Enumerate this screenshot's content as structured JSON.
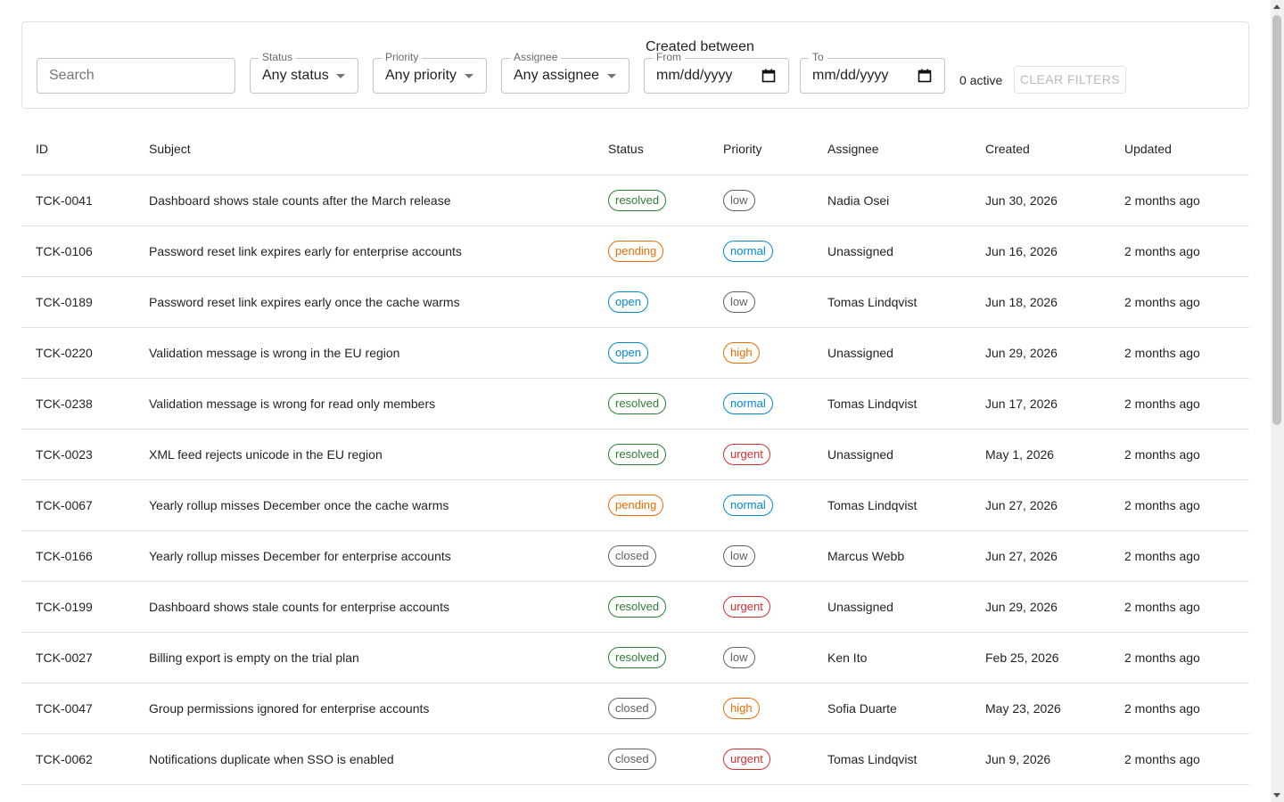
{
  "filters": {
    "search": {
      "placeholder": "Search",
      "value": ""
    },
    "status": {
      "label": "Status",
      "value": "Any status"
    },
    "priority": {
      "label": "Priority",
      "value": "Any priority"
    },
    "assignee": {
      "label": "Assignee",
      "value": "Any assignee"
    },
    "created_group_label": "Created between",
    "from": {
      "label": "From",
      "value": "mm/dd/yyyy"
    },
    "to": {
      "label": "To",
      "value": "mm/dd/yyyy"
    },
    "active_count": "0 active",
    "clear_label": "CLEAR FILTERS"
  },
  "table": {
    "columns": [
      "ID",
      "Subject",
      "Status",
      "Priority",
      "Assignee",
      "Created",
      "Updated"
    ],
    "rows": [
      [
        "TCK-0041",
        "Dashboard shows stale counts after the March release",
        "resolved",
        "low",
        "Nadia Osei",
        "Jun 30, 2026",
        "2 months ago"
      ],
      [
        "TCK-0106",
        "Password reset link expires early for enterprise accounts",
        "pending",
        "normal",
        "Unassigned",
        "Jun 16, 2026",
        "2 months ago"
      ],
      [
        "TCK-0189",
        "Password reset link expires early once the cache warms",
        "open",
        "low",
        "Tomas Lindqvist",
        "Jun 18, 2026",
        "2 months ago"
      ],
      [
        "TCK-0220",
        "Validation message is wrong in the EU region",
        "open",
        "high",
        "Unassigned",
        "Jun 29, 2026",
        "2 months ago"
      ],
      [
        "TCK-0238",
        "Validation message is wrong for read only members",
        "resolved",
        "normal",
        "Tomas Lindqvist",
        "Jun 17, 2026",
        "2 months ago"
      ],
      [
        "TCK-0023",
        "XML feed rejects unicode in the EU region",
        "resolved",
        "urgent",
        "Unassigned",
        "May 1, 2026",
        "2 months ago"
      ],
      [
        "TCK-0067",
        "Yearly rollup misses December once the cache warms",
        "pending",
        "normal",
        "Tomas Lindqvist",
        "Jun 27, 2026",
        "2 months ago"
      ],
      [
        "TCK-0166",
        "Yearly rollup misses December for enterprise accounts",
        "closed",
        "low",
        "Marcus Webb",
        "Jun 27, 2026",
        "2 months ago"
      ],
      [
        "TCK-0199",
        "Dashboard shows stale counts for enterprise accounts",
        "resolved",
        "urgent",
        "Unassigned",
        "Jun 29, 2026",
        "2 months ago"
      ],
      [
        "TCK-0027",
        "Billing export is empty on the trial plan",
        "resolved",
        "low",
        "Ken Ito",
        "Feb 25, 2026",
        "2 months ago"
      ],
      [
        "TCK-0047",
        "Group permissions ignored for enterprise accounts",
        "closed",
        "high",
        "Sofia Duarte",
        "May 23, 2026",
        "2 months ago"
      ],
      [
        "TCK-0062",
        "Notifications duplicate when SSO is enabled",
        "closed",
        "urgent",
        "Tomas Lindqvist",
        "Jun 9, 2026",
        "2 months ago"
      ]
    ]
  },
  "status_colors": {
    "resolved": "#2e7d32",
    "pending": "#ed6c02",
    "open": "#0288d1",
    "closed": "#616161"
  },
  "priority_colors": {
    "low": "#616161",
    "normal": "#0288d1",
    "high": "#ed6c02",
    "urgent": "#d32f2f"
  },
  "icons": {
    "calendar": "calendar-icon",
    "dropdown": "chevron-down-icon"
  }
}
